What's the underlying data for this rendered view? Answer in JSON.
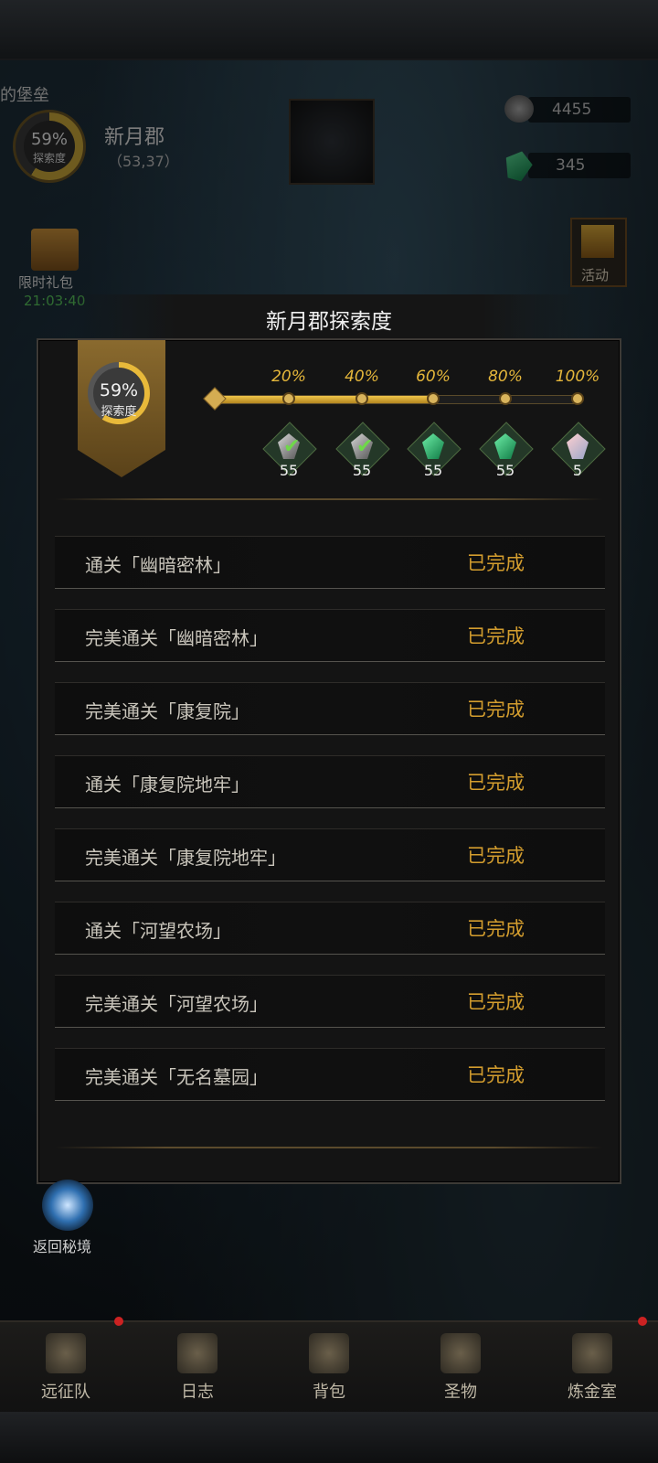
{
  "hud": {
    "region_title_partial": "的堡垒",
    "region_percent": "59%",
    "region_percent_label": "探索度",
    "region_name": "新月郡",
    "region_coords": "（53,37）",
    "currency1": "4455",
    "currency2": "345",
    "gift_label": "限时礼包",
    "gift_timer": "21:03:40",
    "activity_label": "活动",
    "portal_label": "返回秘境"
  },
  "modal": {
    "title": "新月郡探索度",
    "banner_percent": "59%",
    "banner_label": "探索度",
    "progress": 0.59,
    "milestones": [
      {
        "pct": "20%",
        "count": "55",
        "done": true,
        "reward": "stone"
      },
      {
        "pct": "40%",
        "count": "55",
        "done": true,
        "reward": "stone"
      },
      {
        "pct": "60%",
        "count": "55",
        "done": false,
        "reward": "emerald"
      },
      {
        "pct": "80%",
        "count": "55",
        "done": false,
        "reward": "emerald"
      },
      {
        "pct": "100%",
        "count": "5",
        "done": false,
        "reward": "crystal"
      }
    ],
    "tasks": [
      {
        "text": "通关「幽暗密林」",
        "status": "已完成"
      },
      {
        "text": "完美通关「幽暗密林」",
        "status": "已完成"
      },
      {
        "text": "完美通关「康复院」",
        "status": "已完成"
      },
      {
        "text": "通关「康复院地牢」",
        "status": "已完成"
      },
      {
        "text": "完美通关「康复院地牢」",
        "status": "已完成"
      },
      {
        "text": "通关「河望农场」",
        "status": "已完成"
      },
      {
        "text": "完美通关「河望农场」",
        "status": "已完成"
      },
      {
        "text": "完美通关「无名墓园」",
        "status": "已完成"
      }
    ]
  },
  "nav": {
    "items": [
      {
        "label": "远征队",
        "icon": "helmet-icon"
      },
      {
        "label": "日志",
        "icon": "scroll-icon"
      },
      {
        "label": "背包",
        "icon": "bag-icon"
      },
      {
        "label": "圣物",
        "icon": "torch-icon"
      },
      {
        "label": "炼金室",
        "icon": "alchemy-icon"
      }
    ]
  },
  "colors": {
    "accent_gold": "#e5b73b",
    "complete": "#d39d2e",
    "timer_green": "#56c25a"
  }
}
